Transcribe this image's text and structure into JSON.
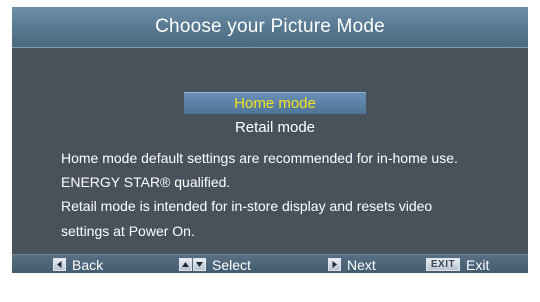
{
  "screen": {
    "title": "Choose your Picture Mode"
  },
  "modes": {
    "selected": "Home mode",
    "home_label": "Home mode",
    "retail_label": "Retail mode"
  },
  "description": {
    "line1": "Home mode default settings are recommended for in-home use.",
    "line2": "ENERGY STAR® qualified.",
    "line3": "Retail mode is intended for in-store display and resets video",
    "line4": "settings at Power On."
  },
  "footer": {
    "back_label": "Back",
    "select_label": "Select",
    "next_label": "Next",
    "exit_key": "EXIT",
    "exit_label": "Exit"
  },
  "colors": {
    "panel_bg": "#48525b",
    "title_bar": "#5d7f96",
    "highlight": "#5b80a5",
    "selected_text": "#f4e21b",
    "text": "#ffffff"
  },
  "icons": {
    "back": "left-arrow-key-icon",
    "select": "up-down-arrow-keys-icon",
    "next": "right-arrow-key-icon",
    "exit": "exit-key-icon"
  }
}
